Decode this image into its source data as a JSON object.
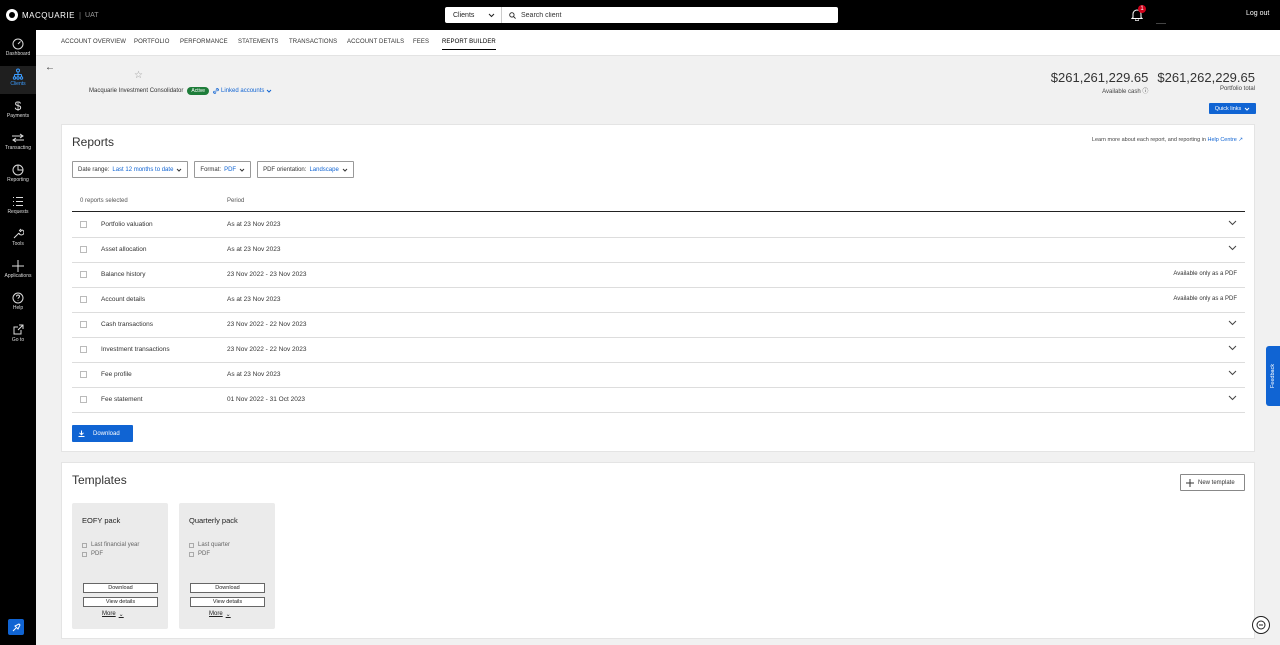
{
  "brand": {
    "name": "MACQUARIE",
    "env": "UAT"
  },
  "search": {
    "scope": "Clients",
    "placeholder": "Search client"
  },
  "notifications": {
    "count": "1"
  },
  "logout_label": "Log out",
  "nav": [
    {
      "label": "Dashboard",
      "icon": "dashboard-icon"
    },
    {
      "label": "Clients",
      "icon": "clients-icon",
      "active": true
    },
    {
      "label": "Payments",
      "icon": "dollar-icon"
    },
    {
      "label": "Transacting",
      "icon": "transfer-icon"
    },
    {
      "label": "Reporting",
      "icon": "pie-chart-icon"
    },
    {
      "label": "Requests",
      "icon": "list-icon"
    },
    {
      "label": "Tools",
      "icon": "wrench-icon"
    },
    {
      "label": "Applications",
      "icon": "plus-icon"
    },
    {
      "label": "Help",
      "icon": "help-icon"
    },
    {
      "label": "Go to",
      "icon": "external-link-icon"
    }
  ],
  "tabs": [
    "ACCOUNT OVERVIEW",
    "PORTFOLIO",
    "PERFORMANCE",
    "STATEMENTS",
    "TRANSACTIONS",
    "ACCOUNT DETAILS",
    "FEES",
    "REPORT BUILDER"
  ],
  "account": {
    "name": "Macquarie Investment Consolidator",
    "status": "Active",
    "linked": "Linked accounts"
  },
  "balances": {
    "available_cash": "$261,261,229.65",
    "available_cash_label": "Available cash",
    "portfolio_total": "$261,262,229.65",
    "portfolio_total_label": "Portfolio total"
  },
  "quick_links": "Quick links",
  "reports": {
    "title": "Reports",
    "help_text": "Learn more about each report, and reporting in",
    "help_link": "Help Centre",
    "filters": {
      "date_label": "Date range:",
      "date_value": "Last 12 months to date",
      "format_label": "Format:",
      "format_value": "PDF",
      "orientation_label": "PDF orientation:",
      "orientation_value": "Landscape"
    },
    "selected_label": "0 reports selected",
    "period_header": "Period",
    "rows": [
      {
        "name": "Portfolio valuation",
        "period": "As at 23 Nov 2023",
        "note": ""
      },
      {
        "name": "Asset allocation",
        "period": "As at 23 Nov 2023",
        "note": ""
      },
      {
        "name": "Balance history",
        "period": "23 Nov 2022 - 23 Nov 2023",
        "note": "Available only as a PDF"
      },
      {
        "name": "Account details",
        "period": "As at 23 Nov 2023",
        "note": "Available only as a PDF"
      },
      {
        "name": "Cash transactions",
        "period": "23 Nov 2022 - 22 Nov 2023",
        "note": ""
      },
      {
        "name": "Investment transactions",
        "period": "23 Nov 2022 - 22 Nov 2023",
        "note": ""
      },
      {
        "name": "Fee profile",
        "period": "As at 23 Nov 2023",
        "note": ""
      },
      {
        "name": "Fee statement",
        "period": "01 Nov 2022 - 31 Oct 2023",
        "note": ""
      }
    ],
    "download_label": "Download"
  },
  "templates": {
    "title": "Templates",
    "new_label": "New template",
    "items": [
      {
        "name": "EOFY pack",
        "period": "Last financial year",
        "format": "PDF",
        "download": "Download",
        "details": "View details",
        "more": "More"
      },
      {
        "name": "Quarterly pack",
        "period": "Last quarter",
        "format": "PDF",
        "download": "Download",
        "details": "View details",
        "more": "More"
      }
    ]
  },
  "feedback_label": "Feedback"
}
